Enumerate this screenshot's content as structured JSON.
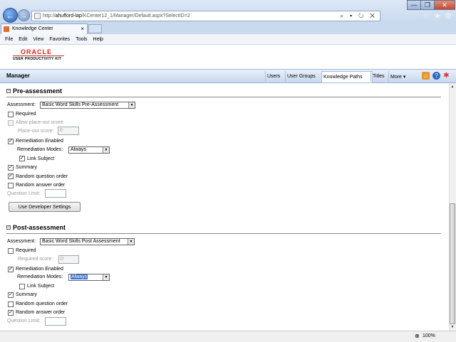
{
  "browser": {
    "url_prefix": "http://",
    "url_host": "ahufford-lap",
    "url_path": "/KCenter12_1/Manager/Default.aspx?SelectID=2",
    "address_controls": "⌕ ▾ ↻ ✕",
    "tab_title": "Knowledge Center",
    "tab_close": "×",
    "window_min": "—",
    "window_max": "❐",
    "window_close": "✕",
    "home_icon": "⌂",
    "star_icon": "★",
    "gear_icon": "⚙",
    "menu": [
      "File",
      "Edit",
      "View",
      "Favorites",
      "Tools",
      "Help"
    ],
    "zoom": "100%",
    "zoom_icon": "⊕"
  },
  "header": {
    "logo": "ORACLE",
    "product": "USER PRODUCTIVITY KIT",
    "section": "Manager",
    "nav": [
      "Users",
      "User Groups",
      "Knowledge Paths",
      "Titles",
      "More ▾"
    ],
    "active_nav": "Knowledge Paths"
  },
  "pre": {
    "title": "Pre-assessment",
    "collapse": "−",
    "assessment_label": "Assessment:",
    "assessment_value": "Basic Word Skills Pre-Assessment",
    "required": "Required",
    "allow_placeout": "Allow place-out score",
    "placeout_label": "Place-out score:",
    "placeout_value": "0",
    "remediation_enabled": "Remediation Enabled",
    "remediation_modes_label": "Remediation Modes:",
    "remediation_modes_value": "Always",
    "link_subject": "Link Subject",
    "summary": "Summary",
    "random_question": "Random question order",
    "random_answer": "Random answer order",
    "question_limit": "Question Limit:",
    "dev_button": "Use Developer Settings"
  },
  "post": {
    "title": "Post-assessment",
    "collapse": "−",
    "assessment_label": "Assessment:",
    "assessment_value": "Basic Word Skills Post Assessment",
    "required": "Required",
    "required_score_label": "Required score:",
    "required_score_value": "0",
    "remediation_enabled": "Remediation Enabled",
    "remediation_modes_label": "Remediation Modes:",
    "remediation_modes_value": "Always",
    "link_subject": "Link Subject",
    "summary": "Summary",
    "random_question": "Random question order",
    "random_answer": "Random answer order",
    "question_limit": "Question Limit:"
  },
  "checks": {
    "pre_required": false,
    "pre_allow_placeout": false,
    "pre_remediation_enabled": true,
    "pre_link_subject": true,
    "pre_summary": true,
    "pre_random_question": true,
    "pre_random_answer": false,
    "post_required": false,
    "post_remediation_enabled": true,
    "post_link_subject": false,
    "post_summary": true,
    "post_random_question": false,
    "post_random_answer": true
  },
  "check_glyph": "✓",
  "dropdown_arrow": "▼",
  "scroll_up": "▲",
  "scroll_down": "▼"
}
